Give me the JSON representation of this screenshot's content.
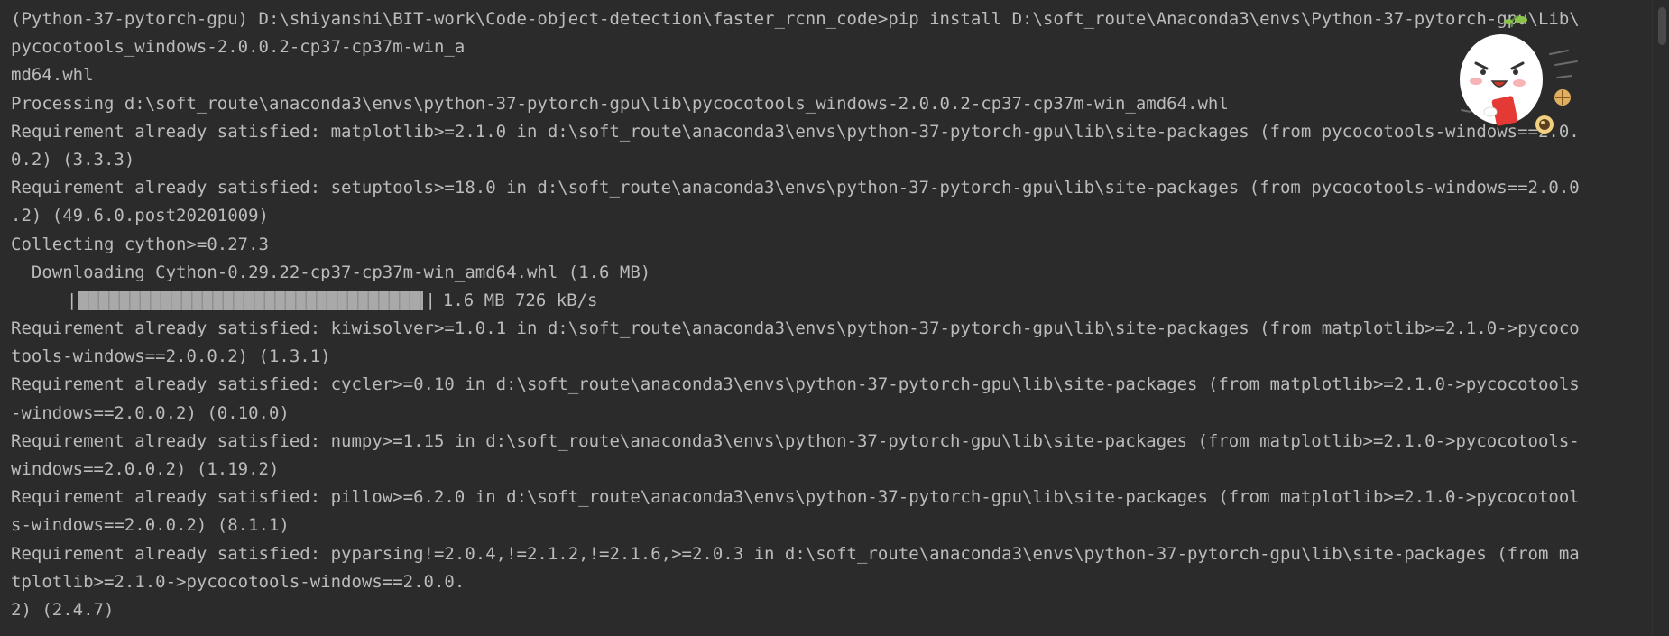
{
  "terminal": {
    "lines": [
      "(Python-37-pytorch-gpu) D:\\shiyanshi\\BIT-work\\Code-object-detection\\faster_rcnn_code>pip install D:\\soft_route\\Anaconda3\\envs\\Python-37-pytorch-gpu\\Lib\\",
      "pycocotools_windows-2.0.0.2-cp37-cp37m-win_a",
      "md64.whl",
      "Processing d:\\soft_route\\anaconda3\\envs\\python-37-pytorch-gpu\\lib\\pycocotools_windows-2.0.0.2-cp37-cp37m-win_amd64.whl",
      "Requirement already satisfied: matplotlib>=2.1.0 in d:\\soft_route\\anaconda3\\envs\\python-37-pytorch-gpu\\lib\\site-packages (from pycocotools-windows==2.0.",
      "0.2) (3.3.3)",
      "Requirement already satisfied: setuptools>=18.0 in d:\\soft_route\\anaconda3\\envs\\python-37-pytorch-gpu\\lib\\site-packages (from pycocotools-windows==2.0.0",
      ".2) (49.6.0.post20201009)",
      "Collecting cython>=0.27.3",
      "  Downloading Cython-0.29.22-cp37-cp37m-win_amd64.whl (1.6 MB)"
    ],
    "progress": {
      "left_edge": "|",
      "right_edge": "|",
      "stats": "1.6 MB 726 kB/s",
      "fraction": 1.0
    },
    "lines_after": [
      "Requirement already satisfied: kiwisolver>=1.0.1 in d:\\soft_route\\anaconda3\\envs\\python-37-pytorch-gpu\\lib\\site-packages (from matplotlib>=2.1.0->pycoco",
      "tools-windows==2.0.0.2) (1.3.1)",
      "Requirement already satisfied: cycler>=0.10 in d:\\soft_route\\anaconda3\\envs\\python-37-pytorch-gpu\\lib\\site-packages (from matplotlib>=2.1.0->pycocotools",
      "-windows==2.0.0.2) (0.10.0)",
      "Requirement already satisfied: numpy>=1.15 in d:\\soft_route\\anaconda3\\envs\\python-37-pytorch-gpu\\lib\\site-packages (from matplotlib>=2.1.0->pycocotools-",
      "windows==2.0.0.2) (1.19.2)",
      "Requirement already satisfied: pillow>=6.2.0 in d:\\soft_route\\anaconda3\\envs\\python-37-pytorch-gpu\\lib\\site-packages (from matplotlib>=2.1.0->pycocotool",
      "s-windows==2.0.0.2) (8.1.1)",
      "Requirement already satisfied: pyparsing!=2.0.4,!=2.1.2,!=2.1.6,>=2.0.3 in d:\\soft_route\\anaconda3\\envs\\python-37-pytorch-gpu\\lib\\site-packages (from ma",
      "tplotlib>=2.1.0->pycocotools-windows==2.0.0.",
      "2) (2.4.7)"
    ]
  },
  "colors": {
    "background": "#2b2b2b",
    "text": "#bbbbbb",
    "progress_bar": "#a9a9a9"
  },
  "sticker": {
    "icon": "cartoon-sticker-icon"
  }
}
